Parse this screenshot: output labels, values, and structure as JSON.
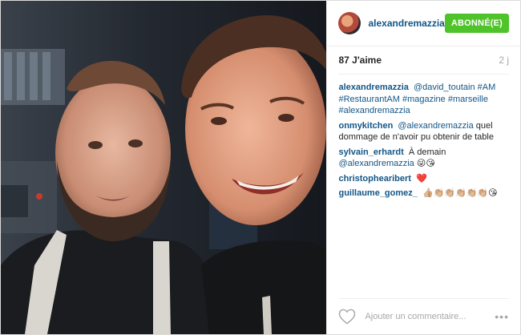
{
  "header": {
    "username": "alexandremazzia",
    "follow_label": "ABONNÉ(E)"
  },
  "stats": {
    "likes": "87 J'aime",
    "time": "2 j"
  },
  "caption": {
    "author": "alexandremazzia",
    "parts": [
      "@david_toutain",
      "#AM",
      "#RestaurantAM",
      "#magazine",
      "#marseille",
      "#alexandremazzia"
    ]
  },
  "comments": [
    {
      "author": "onmykitchen",
      "mention": "@alexandremazzia",
      "text": "quel dommage de n'avoir pu obtenir de table"
    },
    {
      "author": "sylvain_erhardt",
      "text": "À demain",
      "mention": "@alexandremazzia",
      "emoji": "😜😘"
    },
    {
      "author": "christophearibert",
      "emoji": "❤️"
    },
    {
      "author": "guillaume_gomez_",
      "emoji": "👍🏼👏🏼👏🏼👏🏼👏🏼👏🏼😘"
    }
  ],
  "footer": {
    "placeholder": "Ajouter un commentaire...",
    "more": "•••"
  },
  "icons": {
    "heart": "heart-outline-icon",
    "more": "more-options-icon"
  },
  "colors": {
    "link": "#125688",
    "follow_button": "#4fc32a",
    "muted": "#a5a7aa"
  }
}
